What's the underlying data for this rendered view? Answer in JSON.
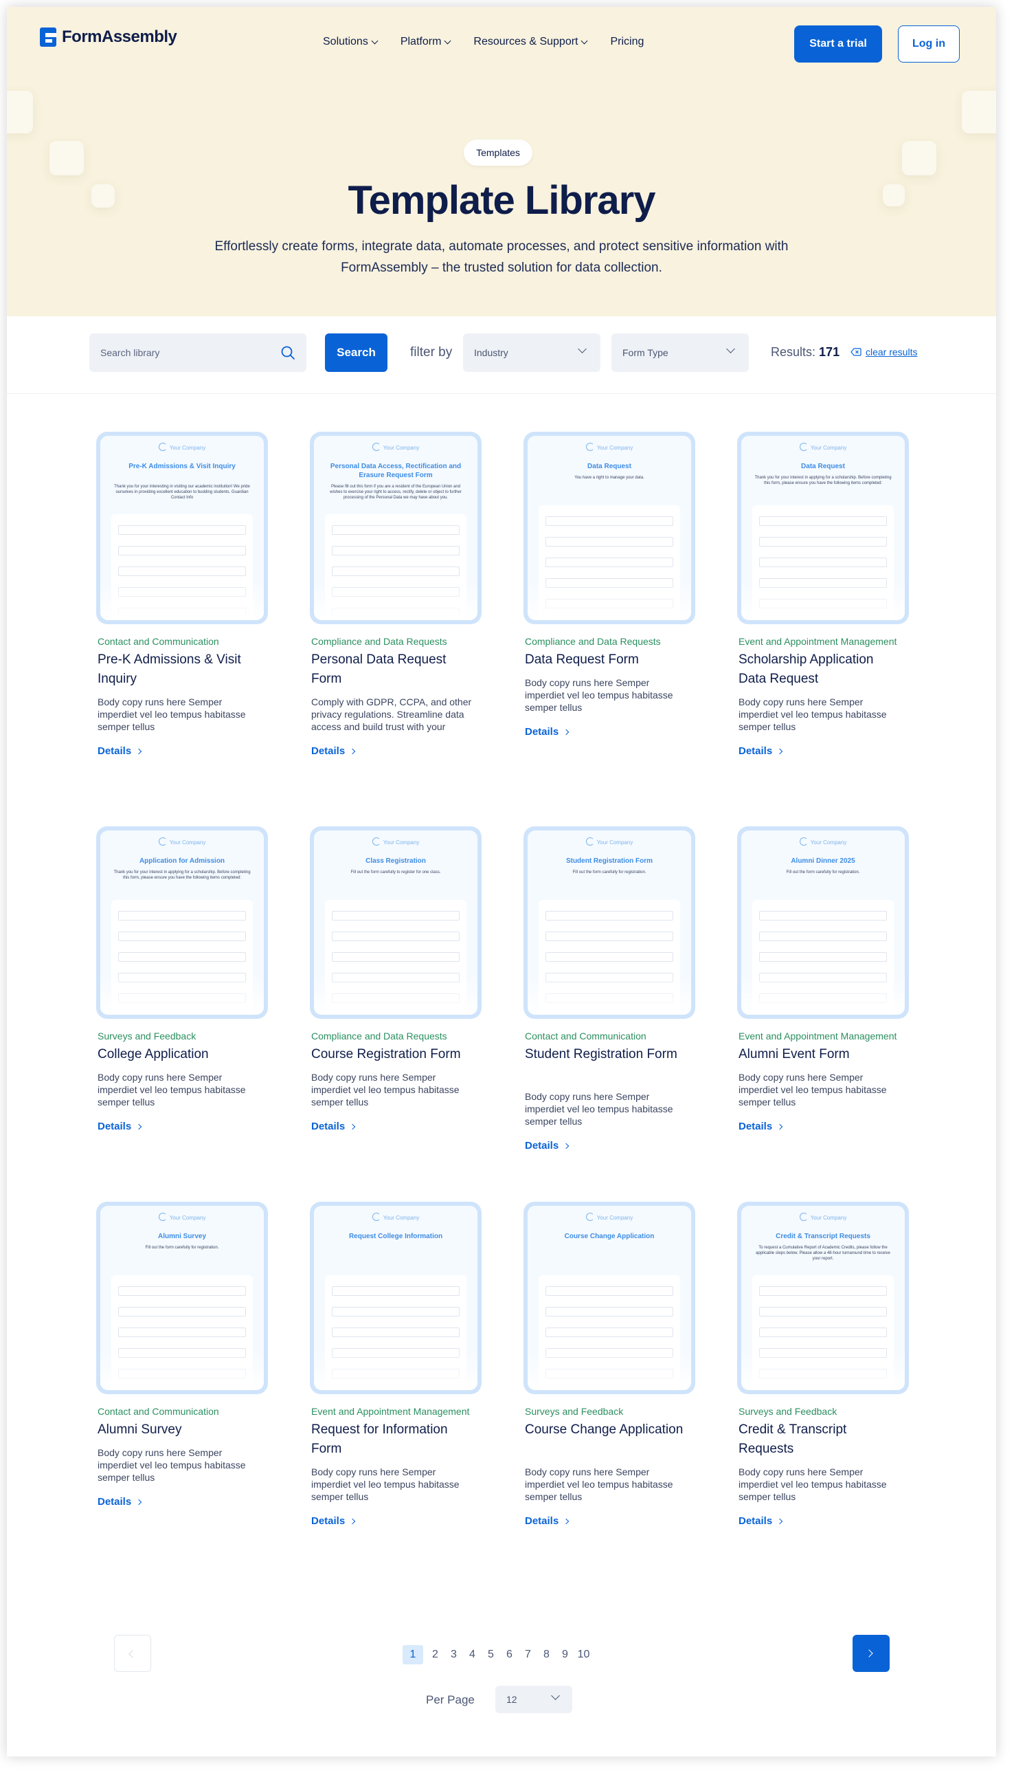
{
  "nav": {
    "logo": "FormAssembly",
    "menu": [
      "Solutions",
      "Platform",
      "Resources & Support",
      "Pricing"
    ],
    "trial": "Start a trial",
    "login": "Log in"
  },
  "hero": {
    "pill": "Templates",
    "title": "Template Library",
    "subtitle": "Effortlessly create forms, integrate data, automate processes, and protect sensitive information with FormAssembly – the trusted solution for data collection."
  },
  "filters": {
    "search_placeholder": "Search library",
    "search_button": "Search",
    "filter_label": "filter by",
    "industry": "Industry",
    "form_type": "Form Type",
    "results_label": "Results:",
    "results_count": "171",
    "clear": "clear results"
  },
  "thumb_brand": "Your Company",
  "cards": [
    {
      "thumb_title": "Pre-K Admissions & Visit Inquiry",
      "thumb_desc": "Thank you for your interesting in visiting our academic institution! We pride ourselves in providing excellent education to budding students. Guardian Contact Info",
      "category": "Contact and Communication",
      "title": "Pre-K Admissions & Visit Inquiry",
      "body": "Body copy runs here Semper imperdiet vel leo tempus habitasse semper tellus",
      "link": "Details"
    },
    {
      "thumb_title": "Personal Data Access, Rectification and Erasure Request Form",
      "thumb_desc": "Please fill out this form if you are a resident of the European Union and wishes to exercise your right to access, rectify, delete or object to further processing of the Personal Data we may have about you.",
      "category": "Compliance and Data Requests",
      "title": "Personal Data Request Form",
      "body": "Comply with GDPR, CCPA, and other privacy regulations. Streamline data access and build trust with your customers.",
      "link": "Details"
    },
    {
      "thumb_title": "Data Request",
      "thumb_desc": "You have a right to manage your data.",
      "category": "Compliance and Data Requests",
      "title": "Data Request Form",
      "body": "Body copy runs here Semper imperdiet vel leo tempus habitasse semper tellus",
      "link": "Details"
    },
    {
      "thumb_title": "Data Request",
      "thumb_desc": "Thank you for your interest in applying for a scholarship. Before completing this form, please ensure you have the following items completed:",
      "category": "Event and Appointment Management",
      "title": "Scholarship Application Data Request",
      "body": "Body copy runs here Semper imperdiet vel leo tempus habitasse semper tellus",
      "link": "Details"
    },
    {
      "thumb_title": "Application for Admission",
      "thumb_desc": "Thank you for your interest in applying for a scholarship. Before completing this form, please ensure you have the following items completed:",
      "category": "Surveys and Feedback",
      "title": "College Application",
      "body": "Body copy runs here Semper imperdiet vel leo tempus habitasse semper tellus",
      "link": "Details"
    },
    {
      "thumb_title": "Class Registration",
      "thumb_desc": "Fill out the form carefully to register for one class.",
      "category": "Compliance and Data Requests",
      "title": "Course Registration Form",
      "body": "Body copy runs here Semper imperdiet vel leo tempus habitasse semper tellus",
      "link": "Details"
    },
    {
      "thumb_title": "Student Registration Form",
      "thumb_desc": "Fill out the form carefully for registration.",
      "category": "Contact and Communication",
      "title": "Student Registration Form",
      "body": "Body copy runs here Semper imperdiet vel leo tempus habitasse semper tellus",
      "link": "Details"
    },
    {
      "thumb_title": "Alumni Dinner 2025",
      "thumb_desc": "Fill out the form carefully for registration.",
      "category": "Event and Appointment Management",
      "title": "Alumni Event Form",
      "body": "Body copy runs here Semper imperdiet vel leo tempus habitasse semper tellus",
      "link": "Details"
    },
    {
      "thumb_title": "Alumni Survey",
      "thumb_desc": "Fill out the form carefully for registration.",
      "category": "Contact and Communication",
      "title": "Alumni Survey",
      "body": "Body copy runs here Semper imperdiet vel leo tempus habitasse semper tellus",
      "link": "Details"
    },
    {
      "thumb_title": "Request College Information",
      "thumb_desc": "",
      "category": "Event and Appointment Management",
      "title": "Request for Information Form",
      "body": "Body copy runs here Semper imperdiet vel leo tempus habitasse semper tellus",
      "link": "Details"
    },
    {
      "thumb_title": "Course Change Application",
      "thumb_desc": "",
      "category": "Surveys and Feedback",
      "title": "Course Change Application",
      "body": "Body copy runs here Semper imperdiet vel leo tempus habitasse semper tellus",
      "link": "Details"
    },
    {
      "thumb_title": "Credit & Transcript Requests",
      "thumb_desc": "To request a Cumulative Report of Academic Credits, please follow the applicable steps below. Please allow a 48-hour turnaround time to receive your report.",
      "category": "Surveys and Feedback",
      "title": "Credit & Transcript Requests",
      "body": "Body copy runs here Semper imperdiet vel leo tempus habitasse semper tellus",
      "link": "Details"
    }
  ],
  "pagination": {
    "pages": [
      "1",
      "2",
      "3",
      "4",
      "5",
      "6",
      "7",
      "8",
      "9",
      "10"
    ],
    "per_page_label": "Per Page",
    "per_page_value": "12"
  }
}
